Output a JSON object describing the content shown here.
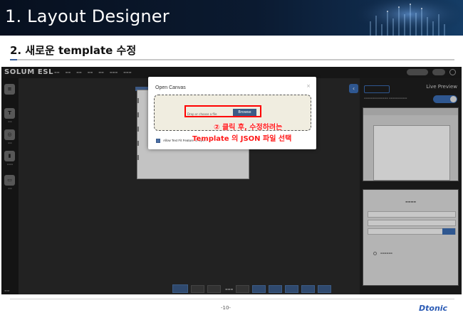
{
  "header": {
    "title": "1. Layout Designer",
    "subtitle": "2. 새로운 template 수정"
  },
  "app": {
    "logo": "SOLUM ESL"
  },
  "modal": {
    "title": "Open Canvas",
    "close_label": "×",
    "drop_text": "Drop or choose a file",
    "browse_label": "Browse",
    "checkbox_label": "Allow Text Fit Feature to UpS...",
    "checkbox_checked": true
  },
  "annotation": {
    "line1": "② 클릭 후, 수정하려는",
    "line2": "Template 의 JSON 파일 선택",
    "color": "#ff1a1a"
  },
  "right_panel": {
    "title": "Live Preview"
  },
  "footer": {
    "page_number": "-10-",
    "brand": "Dtonic"
  }
}
